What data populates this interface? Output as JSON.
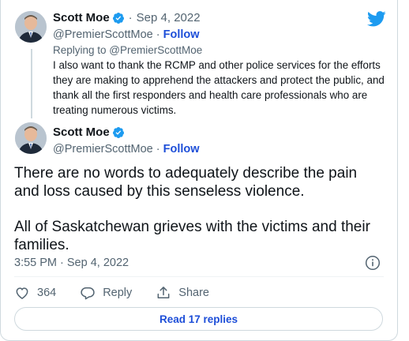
{
  "reply_tweet": {
    "author_name": "Scott Moe",
    "separator": "·",
    "date": "Sep 4, 2022",
    "handle": "@PremierScottMoe",
    "handle_sep": " · ",
    "follow_label": "Follow",
    "replying_to": "Replying to @PremierScottMoe",
    "text": "I also want to thank the RCMP and other police services for the efforts they are making to apprehend the attackers and protect the public, and thank all the first responders and health care professionals who are treating numerous victims."
  },
  "main_tweet": {
    "author_name": "Scott Moe",
    "handle": "@PremierScottMoe",
    "handle_sep": " · ",
    "follow_label": "Follow",
    "paragraphs": [
      "There are no words to adequately describe the pain and loss caused by this senseless violence.",
      "All of Saskatchewan grieves with the victims and their families."
    ],
    "timestamp": "3:55 PM · Sep 4, 2022"
  },
  "actions": {
    "like_count": "364",
    "reply_label": "Reply",
    "share_label": "Share"
  },
  "read_replies_label": "Read 17 replies",
  "colors": {
    "twitter_blue": "#1d9bf0",
    "link_blue": "#1d4ed8",
    "text": "#0f1419",
    "muted": "#536471",
    "border": "#cfd9de"
  },
  "icons": [
    "twitter-logo-icon",
    "verified-badge-icon",
    "info-icon",
    "heart-icon",
    "reply-icon",
    "share-icon"
  ]
}
